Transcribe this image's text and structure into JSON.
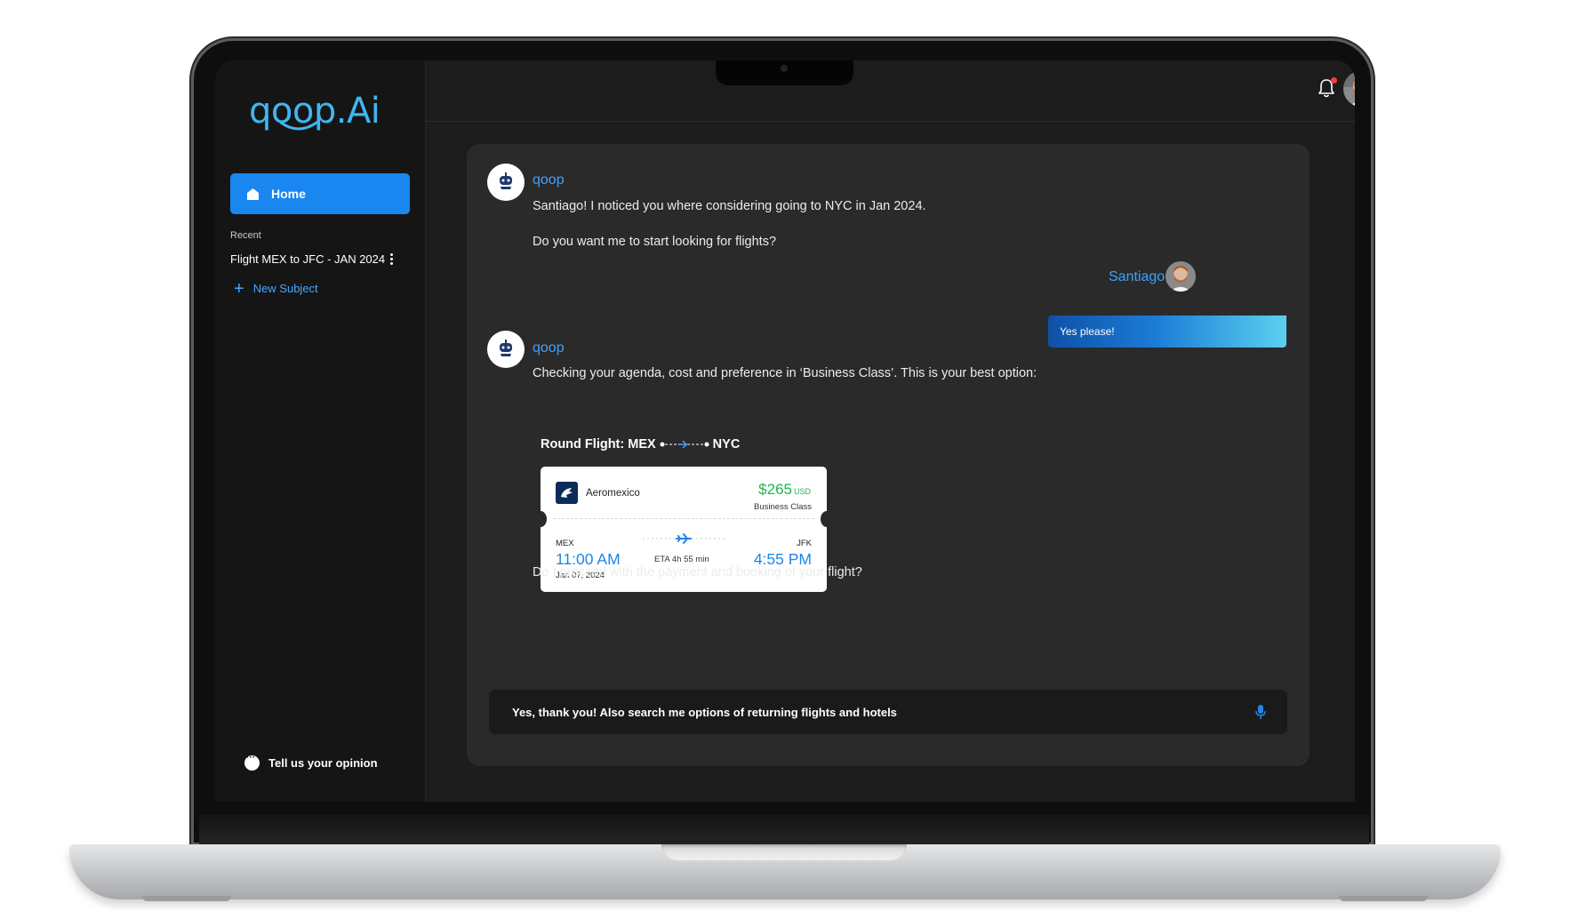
{
  "app": {
    "logo_text": "qoop.Ai"
  },
  "sidebar": {
    "home_label": "Home",
    "recent_label": "Recent",
    "recent_items": [
      {
        "label": "Flight MEX to JFC - JAN 2024"
      }
    ],
    "new_subject_label": "New Subject",
    "opinion_label": "Tell us your opinion"
  },
  "header": {
    "has_notification": true
  },
  "chat": {
    "messages": [
      {
        "sender": "qoop",
        "lines": [
          "Santiago! I noticed you where considering going to NYC in Jan 2024.",
          "Do you want me to start looking for flights?"
        ]
      },
      {
        "sender": "Santiago",
        "text": "Yes please!"
      },
      {
        "sender": "qoop",
        "intro": "Checking your agenda, cost and preference in ‘Business Class’. This is your best option:",
        "route_label": "Round Flight: MEX",
        "route_destination": "NYC",
        "closing": "Do I proceed with the payment and booking of your flight?"
      }
    ],
    "flight_card": {
      "airline": "Aeromexico",
      "price": "$265",
      "currency": "USD",
      "cabin": "Business Class",
      "origin_code": "MEX",
      "departure_time": "11:00 AM",
      "departure_date": "Jan 07, 2024",
      "eta": "ETA 4h 55 min",
      "destination_code": "JFK",
      "arrival_time": "4:55 PM"
    },
    "input": {
      "value": "Yes, thank you! Also search me options of returning flights and hotels"
    }
  },
  "colors": {
    "accent": "#1a86f0",
    "link": "#3fa1ff",
    "price": "#1fb44d",
    "background": "#1c1c1c"
  },
  "icons": [
    "home-icon",
    "kebab-menu-icon",
    "plus-icon",
    "chat-bubble-icon",
    "bell-icon",
    "chevron-down-icon",
    "robot-icon",
    "airplane-icon",
    "microphone-icon"
  ]
}
